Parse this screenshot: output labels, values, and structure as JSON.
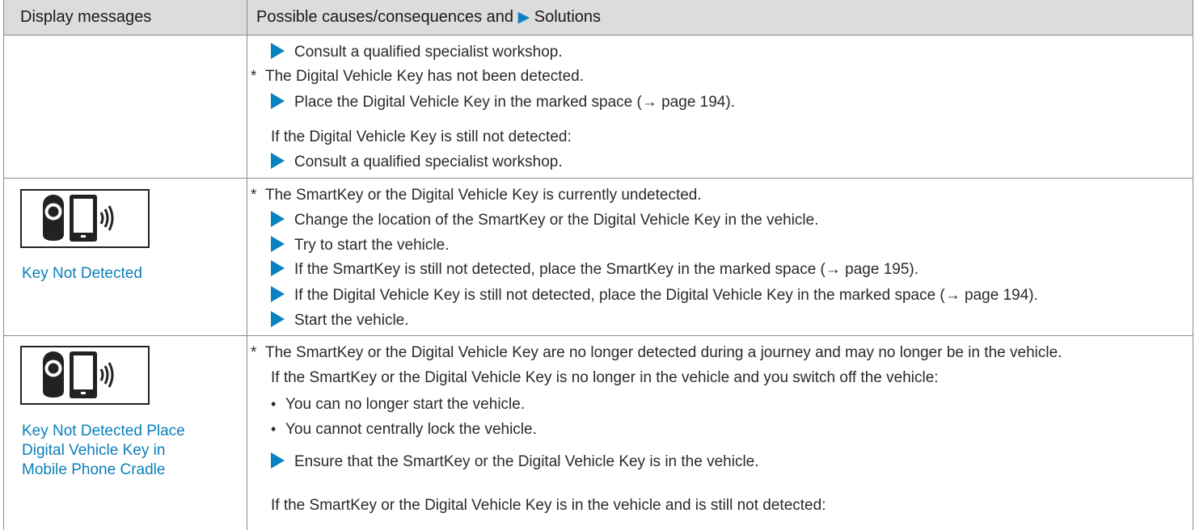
{
  "header": {
    "col1": "Display messages",
    "col2_prefix": "Possible causes/consequences and",
    "col2_arrow": "▶",
    "col2_suffix": "Solutions"
  },
  "row1": {
    "lines": [
      "Consult a qualified specialist workshop.",
      "The Digital Vehicle Key has not been detected.",
      "Place the Digital Vehicle Key in the marked space (→ page 194).",
      "If the Digital Vehicle Key is still not detected:",
      "Consult a qualified specialist workshop."
    ]
  },
  "row2": {
    "message": "Key Not Detected",
    "lines": [
      "The SmartKey or the Digital Vehicle Key is currently undetected.",
      "Change the location of the SmartKey or the Digital Vehicle Key in the vehicle.",
      "Try to start the vehicle.",
      "If the SmartKey is still not detected, place the SmartKey in the marked space (→ page 195).",
      "If the Digital Vehicle Key is still not detected, place the Digital Vehicle Key in the marked space (→ page 194).",
      "Start the vehicle."
    ]
  },
  "row3": {
    "message_lines": [
      "Key Not Detected Place",
      "Digital Vehicle Key in",
      "Mobile Phone Cradle"
    ],
    "lines": [
      "The SmartKey or the Digital Vehicle Key are no longer detected during a journey and may no longer be in the vehicle.",
      "If the SmartKey or the Digital Vehicle Key is no longer in the vehicle and you switch off the vehicle:",
      "You can no longer start the vehicle.",
      "You cannot centrally lock the vehicle.",
      "Ensure that the SmartKey or the Digital Vehicle Key is in the vehicle.",
      "If the SmartKey or the Digital Vehicle Key is in the vehicle and is still not detected:"
    ]
  },
  "symbols": {
    "asterisk": "*",
    "bullet": "•"
  },
  "colors": {
    "accent": "#0a82c0",
    "header_bg": "#dcdcdc"
  }
}
